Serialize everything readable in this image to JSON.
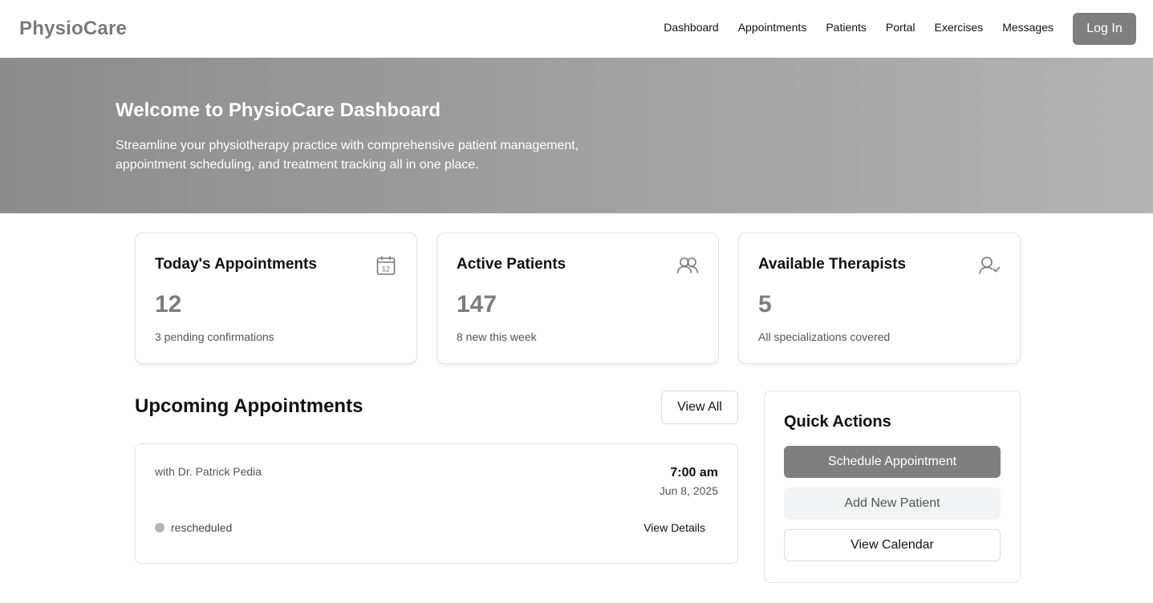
{
  "header": {
    "brand": "PhysioCare",
    "nav": [
      "Dashboard",
      "Appointments",
      "Patients",
      "Portal",
      "Exercises",
      "Messages"
    ],
    "login_label": "Log In"
  },
  "hero": {
    "title": "Welcome to PhysioCare Dashboard",
    "subtitle": "Streamline your physiotherapy practice with comprehensive patient management, appointment scheduling, and treatment tracking all in one place."
  },
  "stats": [
    {
      "title": "Today's Appointments",
      "value": "12",
      "note": "3 pending confirmations",
      "icon": "calendar-icon",
      "icon_text": "12"
    },
    {
      "title": "Active Patients",
      "value": "147",
      "note": "8 new this week",
      "icon": "users-icon"
    },
    {
      "title": "Available Therapists",
      "value": "5",
      "note": "All specializations covered",
      "icon": "user-check-icon"
    }
  ],
  "upcoming": {
    "title": "Upcoming Appointments",
    "view_all_label": "View All",
    "items": [
      {
        "with": "with Dr. Patrick Pedia",
        "time": "7:00 am",
        "date": "Jun 8, 2025",
        "status": "rescheduled",
        "details_label": "View Details"
      }
    ]
  },
  "quick_actions": {
    "title": "Quick Actions",
    "schedule_label": "Schedule Appointment",
    "add_patient_label": "Add New Patient",
    "calendar_label": "View Calendar"
  },
  "colors": {
    "primary_button": "#7f7f7f",
    "status_dot": "#b5b5b5"
  }
}
